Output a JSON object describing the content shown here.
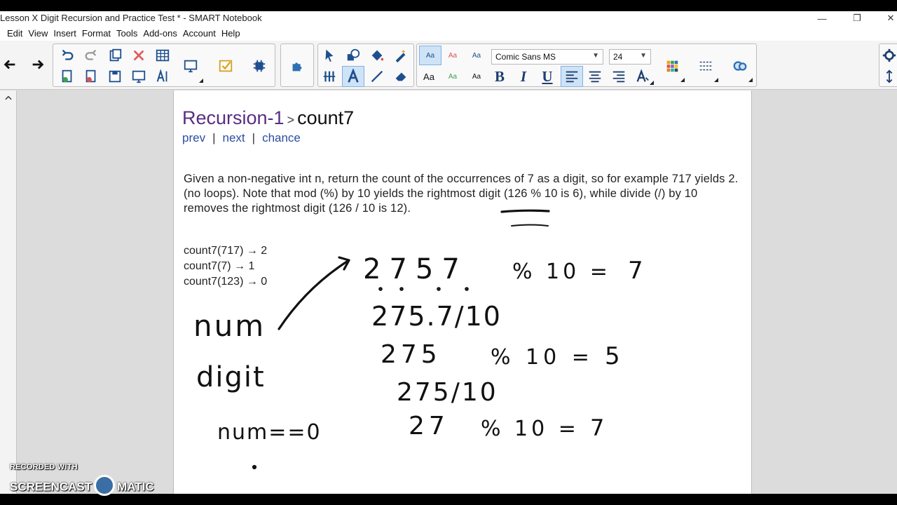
{
  "window": {
    "title": "Lesson X Digit Recursion and Practice Test * - SMART Notebook",
    "minimize_glyph": "—",
    "restore_glyph": "❐",
    "close_glyph": "✕"
  },
  "menu": [
    "Edit",
    "View",
    "Insert",
    "Format",
    "Tools",
    "Add-ons",
    "Account",
    "Help"
  ],
  "toolbar": {
    "font_name": "Comic Sans MS",
    "font_size": "24",
    "text_style_samples": [
      "Aa",
      "Aa",
      "Aa",
      "Aa",
      "Aa",
      "Aa"
    ],
    "bold_label": "B",
    "italic_label": "I",
    "underline_label": "U",
    "icons": [
      "back-arrow-icon",
      "forward-arrow-icon",
      "undo-icon",
      "redo-icon",
      "paste-icon",
      "delete-icon",
      "table-icon",
      "add-page-icon",
      "delete-page-icon",
      "save-icon",
      "screen-shade-icon",
      "text-tool-icon",
      "display-icon",
      "check-icon",
      "widget-icon",
      "puzzle-icon",
      "select-icon",
      "shapes-icon",
      "fill-icon",
      "magic-pen-icon",
      "pen-icon",
      "text-a-icon",
      "line-icon",
      "eraser-icon",
      "align-left-icon",
      "align-center-icon",
      "align-right-icon",
      "text-color-icon",
      "color-grid-icon",
      "line-style-icon",
      "link-icon",
      "settings-icon",
      "resize-icon"
    ],
    "accent": "#1e7bd6"
  },
  "page": {
    "breadcrumb_section": "Recursion-1",
    "breadcrumb_separator": ">",
    "breadcrumb_problem": "count7",
    "nav": {
      "prev": "prev",
      "next": "next",
      "chance": "chance",
      "separator": "|"
    },
    "description": "Given a non-negative int n, return the count of the occurrences of 7 as a digit, so for example 717 yields 2. (no loops). Note that mod (%) by 10 yields the rightmost digit (126 % 10 is 6), while divide (/) by 10 removes the rightmost digit (126 / 10 is 12).",
    "examples": [
      "count7(717) → 2",
      "count7(7) → 1",
      "count7(123) → 0"
    ]
  },
  "handwriting": {
    "line1_number": "2757",
    "line1_op": "% 10 =",
    "line1_result": "7",
    "line2": "275.7/10",
    "line3_number": "275",
    "line3_op": "% 10 =",
    "line3_result": "5",
    "line4": "275/10",
    "line5_number": "27",
    "line5_op": "% 10 =",
    "line5_result": "7",
    "label_num": "num",
    "label_digit": "digit",
    "label_condition": "num==0"
  },
  "watermark": {
    "line1": "RECORDED WITH",
    "line2_left": "SCREENCAST",
    "line2_right": "MATIC"
  },
  "colors": {
    "breadcrumb_section": "#5a2d82",
    "link": "#2a4ea1"
  }
}
